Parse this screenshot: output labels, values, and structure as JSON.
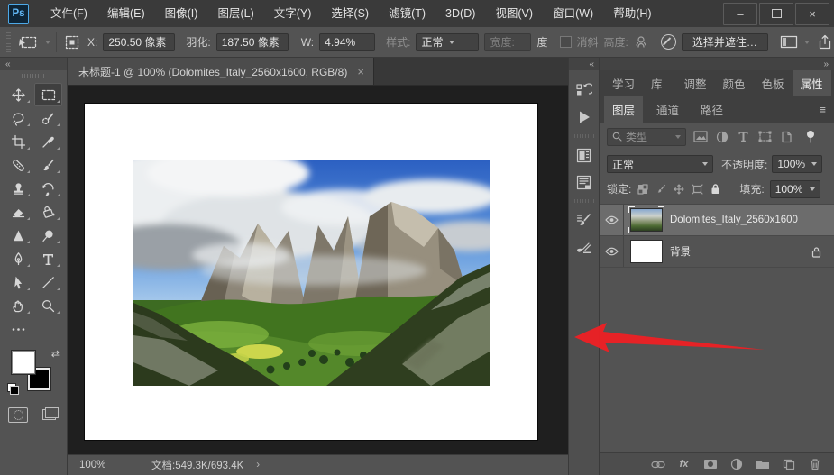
{
  "icons": {
    "hamburger": "≡",
    "collapse_left": "«",
    "collapse_right": "»",
    "chevron_right": "›",
    "close": "×",
    "minimize": "–",
    "fx": "fx",
    "swap_arrows": "⇄",
    "more_dots": "⋯",
    "search_magnifier": "search",
    "play": "actions"
  },
  "menu_bar": {
    "logo": "Ps",
    "items": [
      "文件(F)",
      "编辑(E)",
      "图像(I)",
      "图层(L)",
      "文字(Y)",
      "选择(S)",
      "滤镜(T)",
      "3D(D)",
      "视图(V)",
      "窗口(W)",
      "帮助(H)"
    ]
  },
  "options_bar": {
    "x_label": "X:",
    "x_value": "250.50 像素",
    "feather_label": "羽化:",
    "feather_value": "187.50 像素",
    "w_label": "W:",
    "w_value": "4.94%",
    "style_label": "样式:",
    "style_value": "正常",
    "width_label": "宽度:",
    "degree_suffix": "度",
    "antialias_label": "消斜",
    "height_label": "高度:",
    "select_and_mask_label": "选择并遮住…"
  },
  "document": {
    "tab_title": "未标题-1 @ 100% (Dolomites_Italy_2560x1600, RGB/8)"
  },
  "toolbar": {
    "active_tool": "rectangular-marquee",
    "tools": [
      "move",
      "rectangular-marquee",
      "lasso",
      "quick-selection",
      "crop",
      "eyedropper",
      "spot-healing-brush",
      "brush",
      "clone-stamp",
      "history-brush",
      "eraser",
      "paint-bucket",
      "sharpen",
      "dodge",
      "pen",
      "type",
      "path-selection",
      "line",
      "hand",
      "zoom",
      "edit-toolbar"
    ]
  },
  "right_panels": {
    "tab_group1": {
      "tabs": [
        "学习",
        "库",
        "调整",
        "颜色",
        "色板",
        "属性"
      ],
      "active": "属性"
    },
    "tab_group2": {
      "tabs": [
        "图层",
        "通道",
        "路径"
      ],
      "active": "图层"
    },
    "layers_panel": {
      "filter_type_label": "类型",
      "blend_mode": "正常",
      "opacity_label": "不透明度:",
      "opacity_value": "100%",
      "lock_label": "锁定:",
      "fill_label": "填充:",
      "fill_value": "100%",
      "layers": [
        {
          "name": "Dolomites_Italy_2560x1600",
          "visible": true,
          "selected": true
        },
        {
          "name": "背景",
          "visible": true,
          "locked": true
        }
      ]
    }
  },
  "status_bar": {
    "zoom_level": "100%",
    "document_info": "文档:549.3K/693.4K"
  },
  "colors": {
    "accent_blue": "#31a8ff",
    "annotation_arrow_red": "#ec2024",
    "panel_gray": "#535353",
    "canvas_background": "#1f1f1f",
    "foreground_color": "#ffffff",
    "background_color": "#000000"
  }
}
